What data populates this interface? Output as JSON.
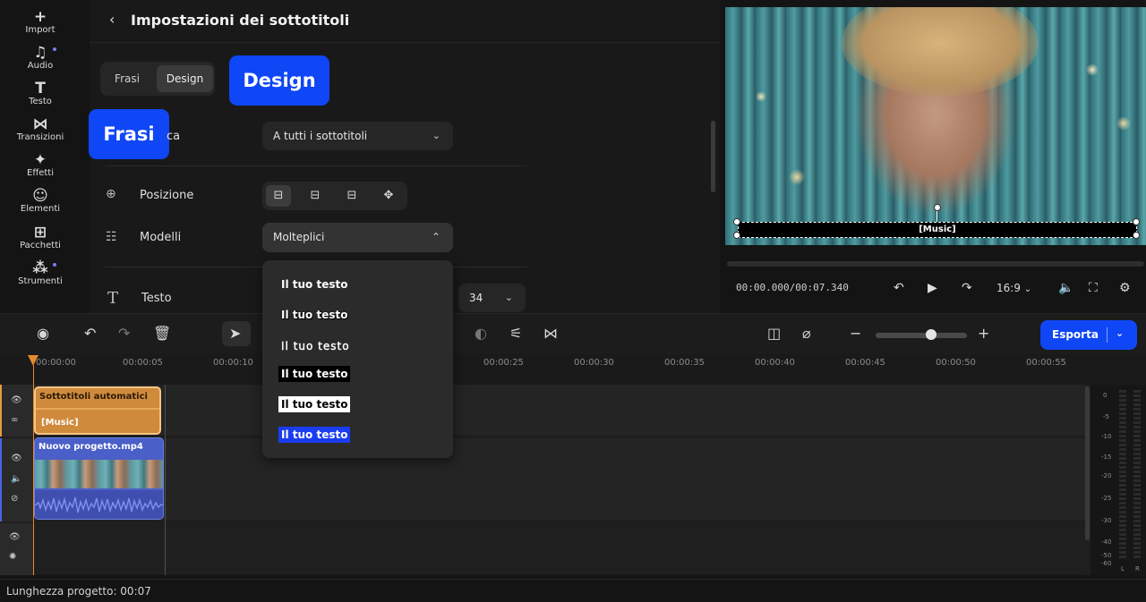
{
  "leftbar": {
    "items": [
      {
        "icon": "plus-icon",
        "glyph": "+",
        "label": "Import"
      },
      {
        "icon": "music-icon",
        "glyph": "♫",
        "label": "Audio"
      },
      {
        "icon": "text-icon",
        "glyph": "T",
        "label": "Testo"
      },
      {
        "icon": "transitions-icon",
        "glyph": "⋈",
        "label": "Transizioni"
      },
      {
        "icon": "effects-icon",
        "glyph": "✦",
        "label": "Effetti"
      },
      {
        "icon": "elements-icon",
        "glyph": "☺",
        "label": "Elementi"
      },
      {
        "icon": "packs-icon",
        "glyph": "⊞",
        "label": "Pacchetti"
      },
      {
        "icon": "tools-icon",
        "glyph": "⁂",
        "label": "Strumenti"
      }
    ]
  },
  "panel": {
    "title": "Impostazioni dei sottotitoli",
    "tabs": {
      "phrases": "Frasi",
      "design": "Design"
    },
    "callouts": {
      "design": "Design",
      "phrases": "Frasi"
    },
    "apply_label_fragment": "ca",
    "apply_select": "A tutti i sottotitoli",
    "position_label": "Posizione",
    "templates_label": "Modelli",
    "templates_select": "Molteplici",
    "text_label": "Testo",
    "font_size": "34"
  },
  "dropdown": {
    "options": [
      "Il tuo testo",
      "Il tuo testo",
      "Il tuo testo",
      "Il tuo testo",
      "Il tuo testo",
      "Il tuo testo"
    ]
  },
  "preview": {
    "subtitle": "[Music]",
    "timecode": "00:00.000/00:07.340",
    "aspect": "16:9"
  },
  "toolbar": {
    "export": "Esporta"
  },
  "ruler": {
    "ticks": [
      "00:00:00",
      "00:00:05",
      "00:00:10",
      "00:00:25",
      "00:00:30",
      "00:00:35",
      "00:00:40",
      "00:00:45",
      "00:00:50",
      "00:00:55"
    ]
  },
  "tracks": {
    "subtitle_clip_title": "Sottotitoli automatici",
    "subtitle_clip_text": "[Music]",
    "video_clip_title": "Nuovo progetto.mp4"
  },
  "meter": {
    "labels": [
      "0",
      "-5",
      "-10",
      "-15",
      "-20",
      "-25",
      "-30",
      "-40",
      "-50",
      "-60"
    ],
    "channels": [
      "L",
      "R"
    ]
  },
  "status": {
    "project_length": "Lunghezza progetto: 00:07"
  },
  "colors": {
    "accent": "#0f46f5",
    "subtitle_clip": "#cf8a3c",
    "video_clip": "#4a5fc7",
    "playhead": "#e58a2c"
  }
}
